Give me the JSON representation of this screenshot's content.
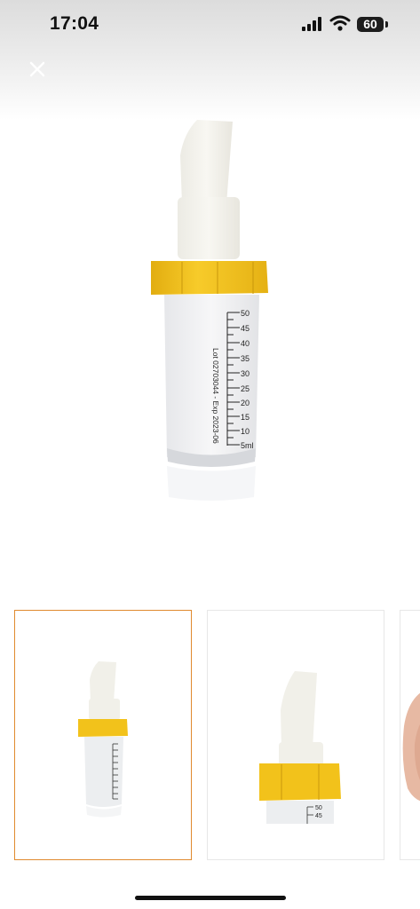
{
  "status_bar": {
    "time": "17:04",
    "battery_level": "60"
  },
  "icons": {
    "close": "close-icon",
    "signal": "cellular-signal-icon",
    "wifi": "wifi-icon",
    "battery": "battery-icon"
  },
  "product_image": {
    "scale_marks": [
      "50",
      "45",
      "40",
      "35",
      "30",
      "25",
      "20",
      "15",
      "10",
      "5ml"
    ],
    "print_text": "Lot 02703044 - Exp 2023-06"
  },
  "gallery": {
    "selected_index": 0,
    "thumb2_marks": [
      "50",
      "45"
    ]
  },
  "colors": {
    "cap_yellow": "#f2c21b",
    "selection_border": "#e08a2e"
  }
}
